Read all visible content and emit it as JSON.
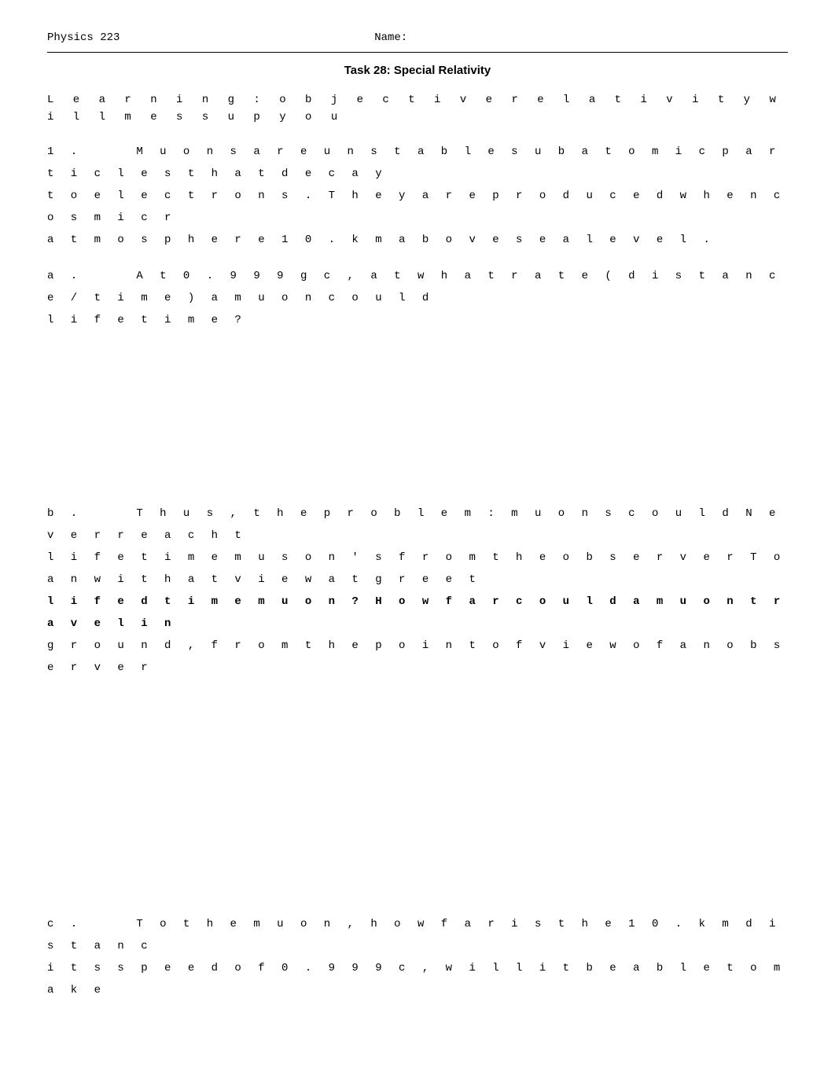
{
  "header": {
    "course": "Physics 223",
    "name_label": "Name:"
  },
  "title": "Task 28: Special Relativity",
  "learning_objective": "L e a r n i n g :  o b j e c t i v e r e l a t i v i t y  w i l l  m e s s  u p  y o u",
  "sections": {
    "intro": {
      "number": "1 .",
      "text_line1": "M u o n s   a r e   u n s t a b l e   s u b a t o m i c   p a r t i c l e s   t h a t   d e c a y",
      "text_line2": "t o   e l e c t r o n s .   T h e y   a r e   p r o d u c e d   w h e n   c o s m i c   r",
      "text_line3": "a t m o s p h e r e   1 0 .   k m   a b o v e   s e a   l e v e l ."
    },
    "part_a": {
      "label": "a .",
      "text_line1": "A t   0 . 9 9 9 g c ,  a t   w h a t   r a t e   ( d i s t a n c e / t i m e )   a   m u o n   c o u l d",
      "text_line2": "l i f e t i m e ?"
    },
    "part_b": {
      "label": "b .",
      "text_line1": "T h u s ,   t h e   p r o b l e m :   m u o n s   c o u l d   N e v e r   r e a c h   t",
      "text_line2": "l i f e t i m e   m u s o n ' s   f r o m   t h e   o b s e r v e r   T o   a n   w i t h   a t   v i e w   a t   g r e e t",
      "text_line3": "l i f e d t i m e   m u o n ?   H o w   f a r   c o u l d   a   m u o n   t r a v e l   i n",
      "text_line4": "g r o u n d ,   f r o m   t h e   p o i n t   o f   v i e w   o f   a n   o b s e r v e r"
    },
    "part_c": {
      "label": "c .",
      "text_line1": "T o   t h e   m u o n ,   h o w   f a r   i s   t h e   1 0 .   k m   d i s t a n c",
      "text_line2": "i t s   s p e e d   o f   0 . 9 9 9   c ,   w i l l   i t   b e   a b l e   t o   m a k e"
    }
  }
}
